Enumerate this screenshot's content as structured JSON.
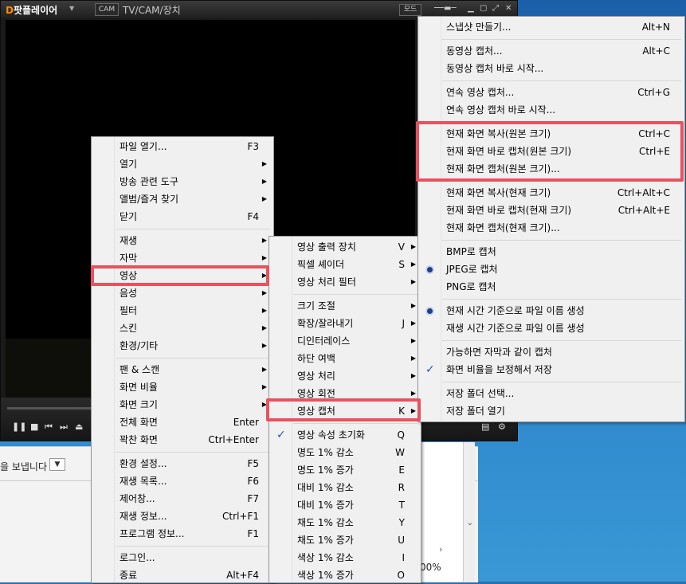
{
  "player": {
    "logo_prefix": "D",
    "logo_text": "팟플레이어",
    "cam_label": "CAM",
    "title": "TV/CAM/장치",
    "mode_label": "모드"
  },
  "background": {
    "sent_text": "을 보냅니다",
    "zoom_text": "00%"
  },
  "main_menu": {
    "items": [
      {
        "label": "파일 열기...",
        "shortcut": "F3",
        "arrow": false
      },
      {
        "label": "열기",
        "shortcut": "",
        "arrow": true
      },
      {
        "label": "방송 관련 도구",
        "shortcut": "",
        "arrow": true
      },
      {
        "label": "앨범/즐겨 찾기",
        "shortcut": "",
        "arrow": true
      },
      {
        "label": "닫기",
        "shortcut": "F4",
        "arrow": false
      },
      {
        "label": "재생",
        "shortcut": "",
        "arrow": true
      },
      {
        "label": "자막",
        "shortcut": "",
        "arrow": true
      },
      {
        "label": "영상",
        "shortcut": "",
        "arrow": true
      },
      {
        "label": "음성",
        "shortcut": "",
        "arrow": true
      },
      {
        "label": "필터",
        "shortcut": "",
        "arrow": true
      },
      {
        "label": "스킨",
        "shortcut": "",
        "arrow": true
      },
      {
        "label": "환경/기타",
        "shortcut": "",
        "arrow": true
      },
      {
        "label": "팬 & 스캔",
        "shortcut": "",
        "arrow": true
      },
      {
        "label": "화면 비율",
        "shortcut": "",
        "arrow": true
      },
      {
        "label": "화면 크기",
        "shortcut": "",
        "arrow": true
      },
      {
        "label": "전체 화면",
        "shortcut": "Enter",
        "arrow": false
      },
      {
        "label": "꽉찬 화면",
        "shortcut": "Ctrl+Enter",
        "arrow": false
      },
      {
        "label": "환경 설정...",
        "shortcut": "F5",
        "arrow": false
      },
      {
        "label": "재생 목록...",
        "shortcut": "F6",
        "arrow": false
      },
      {
        "label": "제어창...",
        "shortcut": "F7",
        "arrow": false
      },
      {
        "label": "재생 정보...",
        "shortcut": "Ctrl+F1",
        "arrow": false
      },
      {
        "label": "프로그램 정보...",
        "shortcut": "F1",
        "arrow": false
      },
      {
        "label": "로그인...",
        "shortcut": "",
        "arrow": false
      },
      {
        "label": "종료",
        "shortcut": "Alt+F4",
        "arrow": false
      }
    ]
  },
  "video_menu": {
    "items": [
      {
        "label": "영상 출력 장치",
        "shortcut": "V",
        "arrow": true
      },
      {
        "label": "픽셀 셰이더",
        "shortcut": "S",
        "arrow": true
      },
      {
        "label": "영상 처리 필터",
        "shortcut": "",
        "arrow": true
      },
      {
        "label": "크기 조절",
        "shortcut": "",
        "arrow": true
      },
      {
        "label": "확장/잘라내기",
        "shortcut": "J",
        "arrow": true
      },
      {
        "label": "디인터레이스",
        "shortcut": "",
        "arrow": true
      },
      {
        "label": "하단 여백",
        "shortcut": "",
        "arrow": true
      },
      {
        "label": "영상 처리",
        "shortcut": "",
        "arrow": true
      },
      {
        "label": "영상 회전",
        "shortcut": "",
        "arrow": true
      },
      {
        "label": "영상 캡처",
        "shortcut": "K",
        "arrow": true
      },
      {
        "label": "영상 속성 초기화",
        "shortcut": "Q",
        "arrow": false,
        "checked": true
      },
      {
        "label": "명도 1% 감소",
        "shortcut": "W",
        "arrow": false
      },
      {
        "label": "명도 1% 증가",
        "shortcut": "E",
        "arrow": false
      },
      {
        "label": "대비 1% 감소",
        "shortcut": "R",
        "arrow": false
      },
      {
        "label": "대비 1% 증가",
        "shortcut": "T",
        "arrow": false
      },
      {
        "label": "채도 1% 감소",
        "shortcut": "Y",
        "arrow": false
      },
      {
        "label": "채도 1% 증가",
        "shortcut": "U",
        "arrow": false
      },
      {
        "label": "색상 1% 감소",
        "shortcut": "I",
        "arrow": false
      },
      {
        "label": "색상 1% 증가",
        "shortcut": "O",
        "arrow": false
      }
    ]
  },
  "capture_menu": {
    "items": [
      {
        "label": "스냅샷 만들기...",
        "shortcut": "Alt+N"
      },
      {
        "label": "동영상 캡처...",
        "shortcut": "Alt+C"
      },
      {
        "label": "동영상 캡처 바로 시작...",
        "shortcut": ""
      },
      {
        "label": "연속 영상 캡처...",
        "shortcut": "Ctrl+G"
      },
      {
        "label": "연속 영상 캡처 바로 시작...",
        "shortcut": ""
      },
      {
        "label": "현재 화면 복사(원본 크기)",
        "shortcut": "Ctrl+C"
      },
      {
        "label": "현재 화면 바로 캡처(원본 크기)",
        "shortcut": "Ctrl+E"
      },
      {
        "label": "현재 화면 캡처(원본 크기)...",
        "shortcut": ""
      },
      {
        "label": "현재 화면 복사(현재 크기)",
        "shortcut": "Ctrl+Alt+C"
      },
      {
        "label": "현재 화면 바로 캡처(현재 크기)",
        "shortcut": "Ctrl+Alt+E"
      },
      {
        "label": "현재 화면 캡처(현재 크기)...",
        "shortcut": ""
      },
      {
        "label": "BMP로 캡처",
        "shortcut": ""
      },
      {
        "label": "JPEG로 캡처",
        "shortcut": "",
        "radio": true
      },
      {
        "label": "PNG로 캡처",
        "shortcut": ""
      },
      {
        "label": "현재 시간 기준으로 파일 이름 생성",
        "shortcut": "",
        "radio": true
      },
      {
        "label": "재생 시간 기준으로 파일 이름 생성",
        "shortcut": ""
      },
      {
        "label": "가능하면 자막과 같이 캡처",
        "shortcut": ""
      },
      {
        "label": "화면 비율을 보정해서 저장",
        "shortcut": "",
        "checked": true
      },
      {
        "label": "저장 폴더 선택...",
        "shortcut": ""
      },
      {
        "label": "저장 폴더 열기",
        "shortcut": ""
      }
    ]
  }
}
